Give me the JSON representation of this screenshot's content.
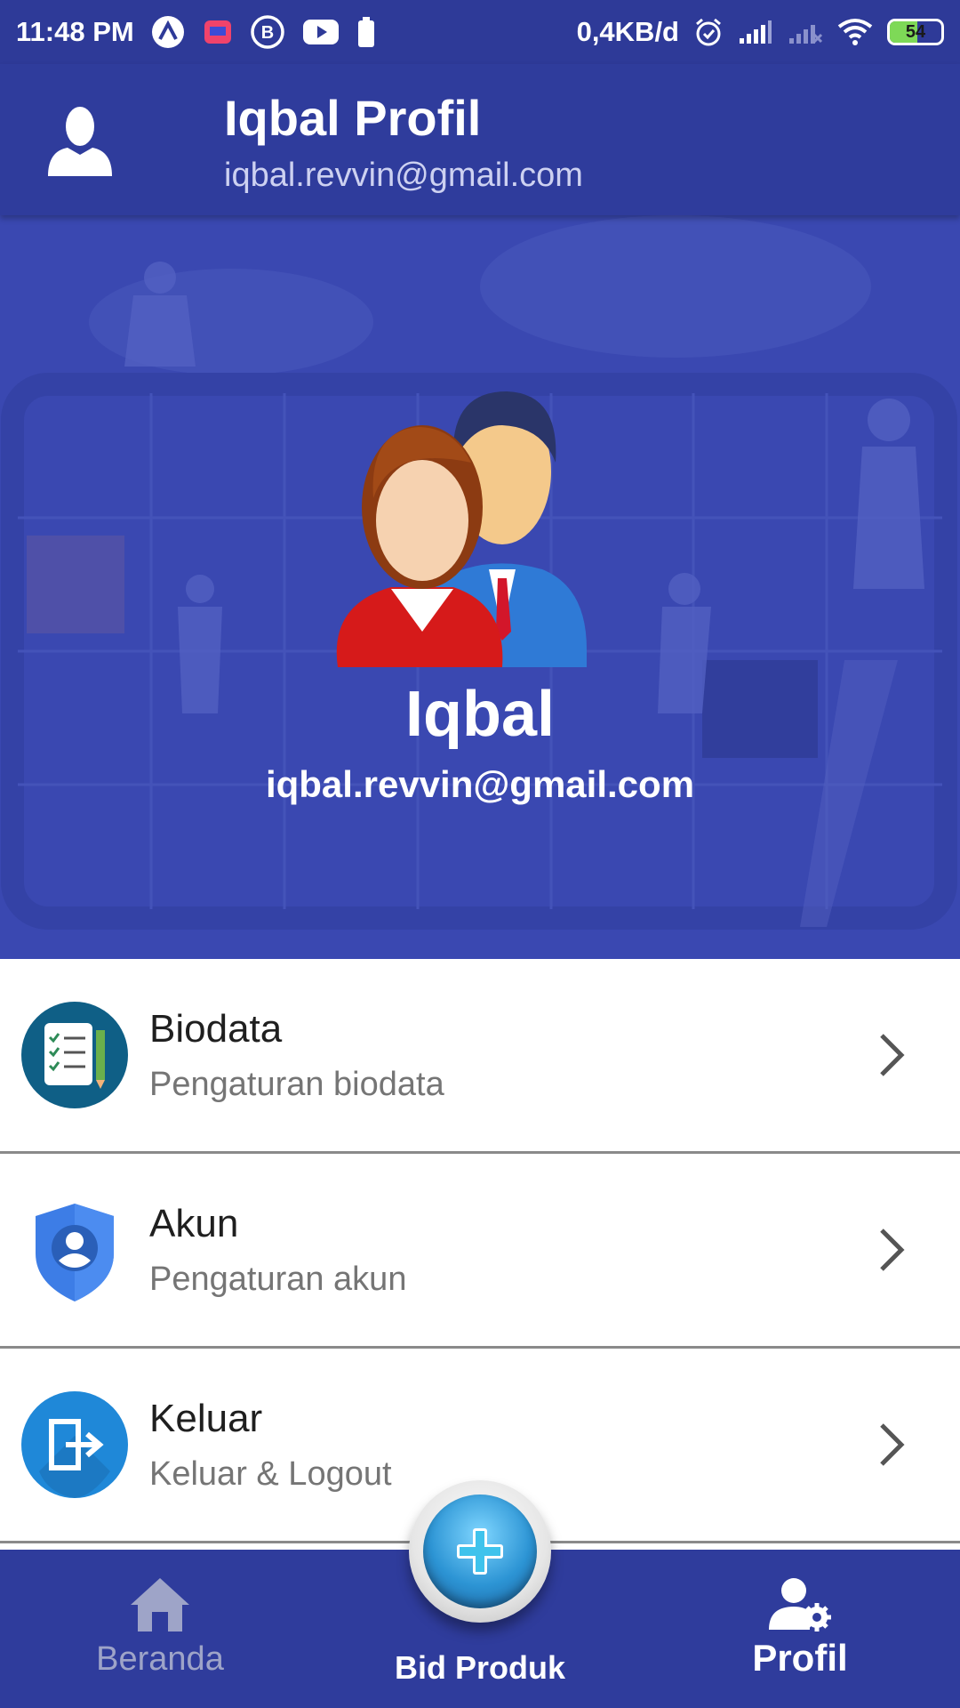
{
  "status_bar": {
    "time": "11:48 PM",
    "data_rate": "0,4KB/d",
    "battery_level": "54",
    "icons": [
      "nova-icon",
      "lazada-icon",
      "b-icon",
      "youtube-icon",
      "battery-small-icon",
      "alarm-icon",
      "signal-icon",
      "signal-off-icon",
      "wifi-icon",
      "battery-icon"
    ]
  },
  "app_bar": {
    "title": "Iqbal Profil",
    "subtitle": "iqbal.revvin@gmail.com",
    "avatar_icon": "user-silhouette-icon"
  },
  "hero": {
    "name": "Iqbal",
    "email": "iqbal.revvin@gmail.com",
    "illustration": "users-illustration-icon",
    "background_color": "#3a48b1"
  },
  "menu": {
    "items": [
      {
        "title": "Biodata",
        "subtitle": "Pengaturan biodata",
        "icon": "biodata-checklist-icon"
      },
      {
        "title": "Akun",
        "subtitle": "Pengaturan akun",
        "icon": "account-shield-icon"
      },
      {
        "title": "Keluar",
        "subtitle": "Keluar & Logout",
        "icon": "logout-icon"
      }
    ]
  },
  "bottom_nav": {
    "items": [
      {
        "label": "Beranda",
        "icon": "home-icon"
      },
      {
        "label": "Bid Produk",
        "icon": "plus-fab-icon"
      },
      {
        "label": "Profil",
        "icon": "user-settings-icon"
      }
    ],
    "active": "Profil"
  },
  "colors": {
    "primary": "#2f3c9c",
    "accent_blue": "#2c94d4",
    "inactive_nav": "#9ea4c8",
    "battery_green": "#7ed957"
  }
}
